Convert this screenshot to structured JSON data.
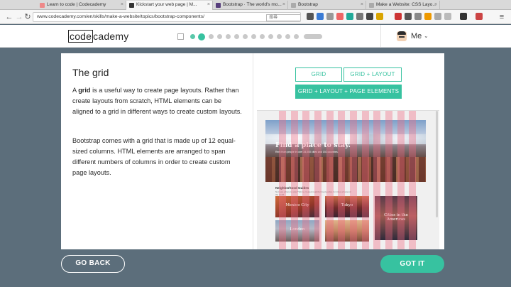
{
  "browser": {
    "tabs": [
      {
        "label": "Learn to code | Codecademy",
        "fav_color": "#e88",
        "active": false
      },
      {
        "label": "Kickstart your web page | M...",
        "fav_color": "#333",
        "active": true
      },
      {
        "label": "Bootstrap · The world's mo...",
        "fav_color": "#563d7c",
        "active": false
      },
      {
        "label": "Bootstrap",
        "fav_color": "#aaa",
        "active": false
      },
      {
        "label": "Make a Website: CSS Layo...",
        "fav_color": "#aaa",
        "active": false
      }
    ],
    "url": "www.codecademy.com/en/skills/make-a-website/topics/bootstrap-components/",
    "search_placeholder": "搜尋"
  },
  "header": {
    "logo_box": "code",
    "logo_rest": "cademy",
    "user_label": "Me",
    "progress": {
      "total_dots": 13,
      "completed": 1,
      "current_index": 1
    }
  },
  "lesson": {
    "title": "The grid",
    "p1_pre": "A ",
    "p1_bold": "grid",
    "p1_post": " is a useful way to create page layouts. Rather than create layouts from scratch, HTML elements can be aligned to a grid in different ways to create custom layouts.",
    "p2": "Bootstrap comes with a grid that is made up of 12 equal-sized columns. HTML elements are arranged to span different numbers of columns in order to create custom page layouts."
  },
  "toggles": {
    "grid": "GRID",
    "grid_layout": "GRID + LAYOUT",
    "grid_layout_elements": "GRID + LAYOUT + PAGE ELEMENTS"
  },
  "preview": {
    "hero_title": "Find a place to stay.",
    "hero_sub": "Rent from people in over 34,000 cities and 192 countries.",
    "section_title": "Neighborhood Guides",
    "section_sub": "Not sure where to stay? We've created neighborhood guides for cities all around the world.",
    "cities": [
      "Mexico City",
      "Tokyo",
      "London"
    ],
    "extra_city_text": "Cities in the Americas",
    "grid_columns": 12
  },
  "footer": {
    "back": "GO BACK",
    "got_it": "GOT IT"
  },
  "colors": {
    "accent": "#37c2a0",
    "backdrop": "#5c6e7b",
    "grid_overlay": "#f06982"
  }
}
